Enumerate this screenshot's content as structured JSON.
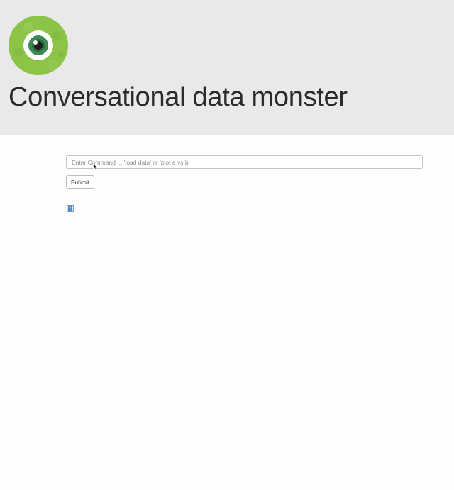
{
  "header": {
    "title": "Conversational data monster",
    "logo_icon": "green-eye-monster-logo",
    "background_color": "#e9e9ea"
  },
  "command": {
    "placeholder": "Enter Command ... 'load data' or 'plot a vs b'",
    "value": "",
    "submit_label": "Submit"
  },
  "output": {
    "image_icon": "broken-image-icon"
  },
  "colors": {
    "logo_green": "#8bc34a",
    "logo_iris": "#3f8b52"
  }
}
